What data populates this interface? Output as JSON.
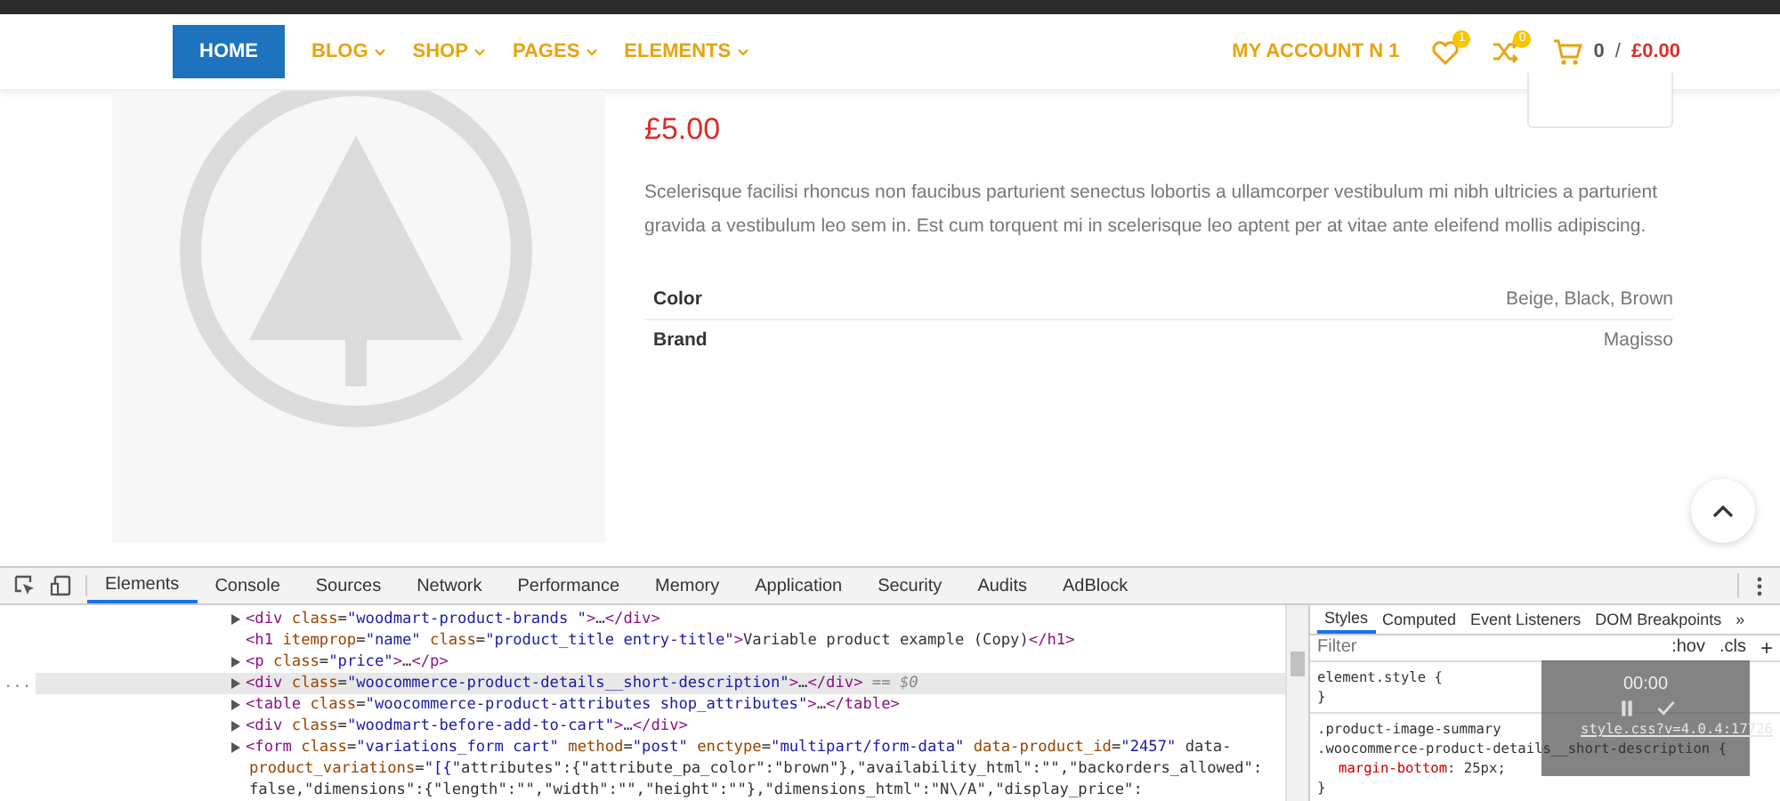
{
  "header": {
    "nav": [
      {
        "label": "HOME",
        "selected": true,
        "dropdown": false
      },
      {
        "label": "BLOG",
        "selected": false,
        "dropdown": true
      },
      {
        "label": "SHOP",
        "selected": false,
        "dropdown": true
      },
      {
        "label": "PAGES",
        "selected": false,
        "dropdown": true
      },
      {
        "label": "ELEMENTS",
        "selected": false,
        "dropdown": true
      }
    ],
    "account": "MY ACCOUNT N 1",
    "wishlist_count": "1",
    "compare_count": "0",
    "cart_count": "0",
    "cart_separator": "/",
    "cart_total": "£0.00"
  },
  "product": {
    "price": "£5.00",
    "description": "Scelerisque facilisi rhoncus non faucibus parturient senectus lobortis a ullamcorper vestibulum mi nibh ultricies a parturient gravida a vestibulum leo sem in. Est cum torquent mi in scelerisque leo aptent per at vitae ante eleifend mollis adipiscing.",
    "attributes": [
      {
        "name": "Color",
        "value": "Beige, Black, Brown"
      },
      {
        "name": "Brand",
        "value": "Magisso"
      }
    ]
  },
  "devtools": {
    "tabs": [
      {
        "label": "Elements",
        "selected": true
      },
      {
        "label": "Console",
        "selected": false
      },
      {
        "label": "Sources",
        "selected": false
      },
      {
        "label": "Network",
        "selected": false
      },
      {
        "label": "Performance",
        "selected": false
      },
      {
        "label": "Memory",
        "selected": false
      },
      {
        "label": "Application",
        "selected": false
      },
      {
        "label": "Security",
        "selected": false
      },
      {
        "label": "Audits",
        "selected": false
      },
      {
        "label": "AdBlock",
        "selected": false
      }
    ],
    "gutter_mark": "...",
    "dom": [
      {
        "code": "<div class=\"woodmart-product-brands \">…</div>",
        "collapsed": true,
        "selected": false
      },
      {
        "code": "<h1 itemprop=\"name\" class=\"product_title entry-title\">Variable product example (Copy)</h1>",
        "collapsed": false,
        "selected": false
      },
      {
        "code": "<p class=\"price\">…</p>",
        "collapsed": true,
        "selected": false
      },
      {
        "code": "<div class=\"woocommerce-product-details__short-description\">…</div> == $0",
        "collapsed": true,
        "selected": true
      },
      {
        "code": "<table class=\"woocommerce-product-attributes shop_attributes\">…</table>",
        "collapsed": true,
        "selected": false
      },
      {
        "code": "<div class=\"woodmart-before-add-to-cart\">…</div>",
        "collapsed": true,
        "selected": false
      },
      {
        "code": "<form class=\"variations_form cart\" method=\"post\" enctype=\"multipart/form-data\" data-product_id=\"2457\" data-",
        "collapsed": true,
        "selected": false
      },
      {
        "code": "product_variations=\"[{\"attributes\":{\"attribute_pa_color\":\"brown\"},\"availability_html\":\"\",\"backorders_allowed\":",
        "collapsed": false,
        "selected": false
      },
      {
        "code": "false,\"dimensions\":{\"length\":\"\",\"width\":\"\",\"height\":\"\"},\"dimensions_html\":\"N\\/A\",\"display_price\":",
        "collapsed": false,
        "selected": false
      }
    ],
    "side_tabs": [
      {
        "label": "Styles",
        "selected": true
      },
      {
        "label": "Computed",
        "selected": false
      },
      {
        "label": "Event Listeners",
        "selected": false
      },
      {
        "label": "DOM Breakpoints",
        "selected": false
      }
    ],
    "side_more": "»",
    "filter": {
      "placeholder": "Filter"
    },
    "hov": ":hov",
    "cls": ".cls",
    "add": "+",
    "element_style": {
      "selector": "element.style {",
      "close": "}"
    },
    "rule": {
      "selectors": [
        ".product-image-summary",
        ".woocommerce-product-details__short-description {"
      ],
      "source": "style.css?v=4.0.4:17726",
      "property": "margin-bottom",
      "separator": ":",
      "value": "25px;",
      "close": "}"
    },
    "recorder": {
      "time": "00:00"
    }
  }
}
